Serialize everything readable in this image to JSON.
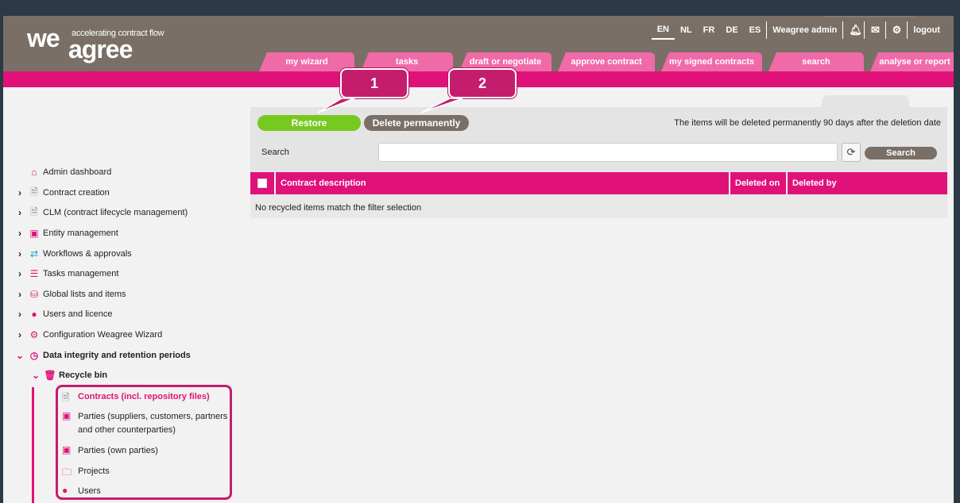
{
  "logo": {
    "we": "we",
    "agree": "agree",
    "tagline": "accelerating contract flow"
  },
  "toplinks": {
    "langs": [
      "EN",
      "NL",
      "FR",
      "DE",
      "ES"
    ],
    "active_lang": "EN",
    "user": "Weagree admin",
    "logout": "logout"
  },
  "icons": {
    "bell": "bell-icon",
    "mail": "mail-icon",
    "gear": "gear-icon"
  },
  "tabs": [
    "my wizard",
    "tasks",
    "draft or negotiate",
    "approve contract",
    "my signed contracts",
    "search",
    "analyse or report"
  ],
  "toolbar": {
    "restore_label": "Restore",
    "delete_label": "Delete permanently",
    "notice": "The items will be deleted permanently 90 days after the deletion date",
    "search_label": "Search",
    "search_value": "",
    "search_button": "Search"
  },
  "table": {
    "columns": [
      "Contract description",
      "Deleted on",
      "Deleted by"
    ],
    "empty_message": "No recycled items match the filter selection"
  },
  "sidebar": {
    "items": [
      {
        "label": "Admin dashboard",
        "icon": "home-icon",
        "expandable": false
      },
      {
        "label": "Contract creation",
        "icon": "document-icon",
        "expandable": true
      },
      {
        "label": "CLM (contract lifecycle management)",
        "icon": "document-icon",
        "expandable": true
      },
      {
        "label": "Entity management",
        "icon": "contact-card-icon",
        "expandable": true
      },
      {
        "label": "Workflows & approvals",
        "icon": "workflow-icon",
        "expandable": true
      },
      {
        "label": "Tasks management",
        "icon": "tasks-icon",
        "expandable": true
      },
      {
        "label": "Global lists and items",
        "icon": "database-icon",
        "expandable": true
      },
      {
        "label": "Users and licence",
        "icon": "user-icon",
        "expandable": true
      },
      {
        "label": "Configuration Weagree Wizard",
        "icon": "gears-icon",
        "expandable": true
      },
      {
        "label": "Data integrity and retention periods",
        "icon": "clock-icon",
        "expandable": true,
        "expanded": true
      }
    ],
    "recycle_bin": {
      "label": "Recycle bin",
      "icon": "trash-icon"
    },
    "recycle_items": [
      {
        "label": "Contracts (incl. repository files)",
        "icon": "document-icon",
        "active": true
      },
      {
        "label": "Parties (suppliers, customers, partners and other counterparties)",
        "icon": "contact-card-icon"
      },
      {
        "label": "Parties (own parties)",
        "icon": "contact-card-icon"
      },
      {
        "label": "Projects",
        "icon": "folder-icon"
      },
      {
        "label": "Users",
        "icon": "user-icon"
      }
    ]
  },
  "callouts": [
    "1",
    "2"
  ],
  "colors": {
    "brand_pink": "#e0127a",
    "header_taupe": "#7a6f66",
    "restore_green": "#77c81f",
    "callout": "#c51d6e"
  }
}
